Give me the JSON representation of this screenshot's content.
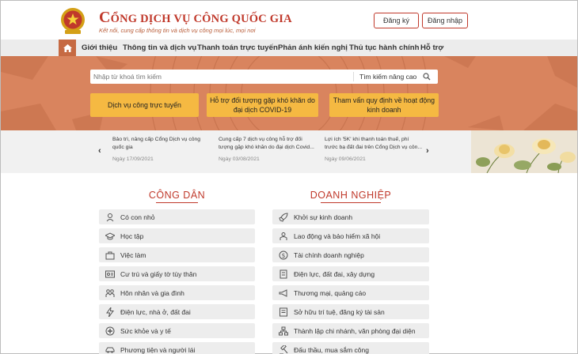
{
  "header": {
    "title_first": "C",
    "title_rest": "ỔNG DỊCH VỤ CÔNG QUỐC GIA",
    "subtitle": "Kết nối, cung cấp thông tin và dịch vụ công mọi lúc, mọi nơi",
    "register_label": "Đăng ký",
    "login_label": "Đăng nhập"
  },
  "nav": {
    "items": [
      {
        "label": "Giới thiệu"
      },
      {
        "label": "Thông tin và dịch vụ"
      },
      {
        "label": "Thanh toán trực tuyến"
      },
      {
        "label": "Phản ánh kiến nghị"
      },
      {
        "label": "Thủ tục hành chính"
      },
      {
        "label": "Hỗ trợ"
      }
    ]
  },
  "search": {
    "placeholder": "Nhập từ khoá tìm kiếm",
    "advanced_label": "Tìm kiếm nâng cao"
  },
  "quick_buttons": [
    {
      "label": "Dịch vụ công trực tuyến"
    },
    {
      "label": "Hỗ trợ đối tượng gặp khó khăn do đại dịch COVID-19"
    },
    {
      "label": "Tham vấn quy định về hoạt động kinh doanh"
    }
  ],
  "news": [
    {
      "text": "Bảo trì, nâng cấp Cổng Dịch vụ công quốc gia",
      "date": "Ngày 17/09/2021"
    },
    {
      "text": "Cung cấp 7 dịch vụ công hỗ trợ đối tượng gặp khó khăn do đại dịch Covid...",
      "date": "Ngày 03/08/2021"
    },
    {
      "text": "Lợi ích '5K' khi thanh toán thuế, phí trước bạ đất đai trên Cổng Dịch vụ côn...",
      "date": "Ngày 09/06/2021"
    }
  ],
  "citizen": {
    "title": "CÔNG DÂN",
    "items": [
      {
        "label": "Có con nhỏ",
        "icon": "baby-icon"
      },
      {
        "label": "Học tập",
        "icon": "graduation-cap-icon"
      },
      {
        "label": "Việc làm",
        "icon": "briefcase-icon"
      },
      {
        "label": "Cư trú và giấy tờ tùy thân",
        "icon": "id-card-icon"
      },
      {
        "label": "Hôn nhân và gia đình",
        "icon": "family-icon"
      },
      {
        "label": "Điện lực, nhà ở, đất đai",
        "icon": "lightning-icon"
      },
      {
        "label": "Sức khỏe và y tế",
        "icon": "medical-icon"
      },
      {
        "label": "Phương tiện và người lái",
        "icon": "car-icon"
      }
    ]
  },
  "business": {
    "title": "DOANH NGHIỆP",
    "items": [
      {
        "label": "Khởi sự kinh doanh",
        "icon": "rocket-icon"
      },
      {
        "label": "Lao động và bảo hiểm xã hội",
        "icon": "worker-icon"
      },
      {
        "label": "Tài chính doanh nghiệp",
        "icon": "dollar-icon"
      },
      {
        "label": "Điện lực, đất đai, xây dựng",
        "icon": "building-icon"
      },
      {
        "label": "Thương mại, quảng cáo",
        "icon": "megaphone-icon"
      },
      {
        "label": "Sở hữu trí tuệ, đăng ký tài sản",
        "icon": "certificate-icon"
      },
      {
        "label": "Thành lập chi nhánh, văn phòng đại diện",
        "icon": "branch-icon"
      },
      {
        "label": "Đấu thầu, mua sắm công",
        "icon": "gavel-icon"
      }
    ]
  },
  "colors": {
    "brand_red": "#c0392b",
    "hero_orange": "#d9845e",
    "button_yellow": "#f5b942"
  }
}
